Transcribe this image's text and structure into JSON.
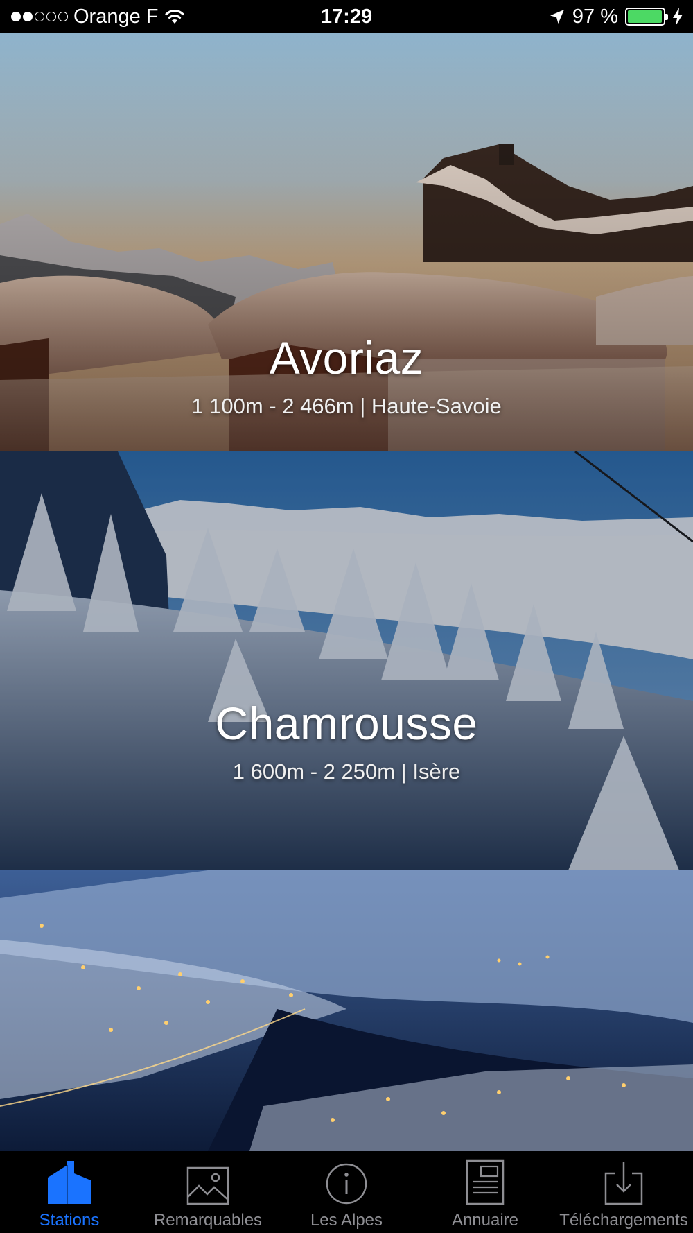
{
  "status_bar": {
    "carrier": "Orange F",
    "time": "17:29",
    "battery_percent": "97 %",
    "battery_level": 0.97,
    "signal_bars_filled": 2,
    "signal_bars_total": 5
  },
  "stations": [
    {
      "name": "Avoriaz",
      "info": "1 100m - 2 466m | Haute-Savoie"
    },
    {
      "name": "Chamrousse",
      "info": "1 600m - 2 250m | Isère"
    },
    {
      "name": "",
      "info": ""
    }
  ],
  "tab_bar": {
    "active": "Stations",
    "tabs": [
      {
        "label": "Stations",
        "icon": "house-icon"
      },
      {
        "label": "Remarquables",
        "icon": "image-icon"
      },
      {
        "label": "Les Alpes",
        "icon": "info-icon"
      },
      {
        "label": "Annuaire",
        "icon": "document-icon"
      },
      {
        "label": "Téléchargements",
        "icon": "download-icon"
      }
    ]
  },
  "colors": {
    "accent": "#1a73ff",
    "tab_inactive": "#8e8e93",
    "battery": "#4cd964"
  }
}
